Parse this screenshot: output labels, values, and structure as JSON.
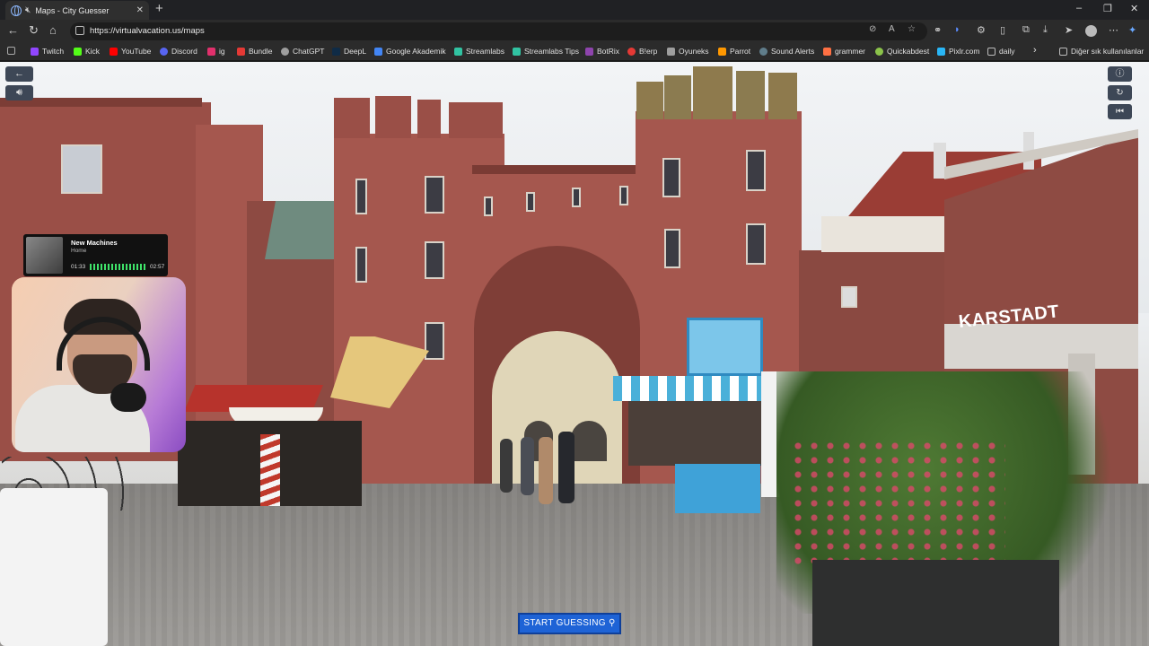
{
  "browser": {
    "tab_title": "Maps - City Guesser",
    "url": "https://virtualvacation.us/maps",
    "new_tab": "+",
    "window_controls": [
      "–",
      "❐",
      "✕"
    ]
  },
  "bookmarks": {
    "items": [
      {
        "label": "Twitch",
        "color": "#9146ff"
      },
      {
        "label": "Kick",
        "color": "#53fc18"
      },
      {
        "label": "YouTube",
        "color": "#ff0000"
      },
      {
        "label": "Discord",
        "color": "#5865f2"
      },
      {
        "label": "ig",
        "color": "#e1306c"
      },
      {
        "label": "Bundle",
        "color": "#e53935"
      },
      {
        "label": "ChatGPT",
        "color": "#9e9e9e"
      },
      {
        "label": "DeepL",
        "color": "#0f2b46"
      },
      {
        "label": "Google Akademik",
        "color": "#4285f4"
      },
      {
        "label": "Streamlabs",
        "color": "#31c3a2"
      },
      {
        "label": "Streamlabs Tips",
        "color": "#31c3a2"
      },
      {
        "label": "BotRix",
        "color": "#8e44ad"
      },
      {
        "label": "B!erp",
        "color": "#e53935"
      },
      {
        "label": "Oyuneks",
        "color": "#9e9e9e"
      },
      {
        "label": "Parrot",
        "color": "#ff9800"
      },
      {
        "label": "Sound Alerts",
        "color": "#607d8b"
      },
      {
        "label": "grammer",
        "color": "#ff7043"
      },
      {
        "label": "Quickabdest",
        "color": "#8bc34a"
      },
      {
        "label": "Pixlr.com",
        "color": "#29b6f6"
      },
      {
        "label": "daily",
        "color": "#bdbdbd"
      }
    ],
    "more": "›",
    "other_folder": "Diğer sık kullanılanlar"
  },
  "now_playing": {
    "song": "New Machines",
    "artist": "Home",
    "elapsed": "01:33",
    "duration": "02:57"
  },
  "scene": {
    "store_sign": "KARSTADT"
  },
  "game": {
    "start_button": "START GUESSING"
  },
  "icons": {
    "back": "back-arrow-icon",
    "sound": "speaker-icon",
    "info": "info-icon",
    "refresh": "refresh-icon",
    "restart": "restart-icon",
    "pin": "map-pin-icon"
  }
}
